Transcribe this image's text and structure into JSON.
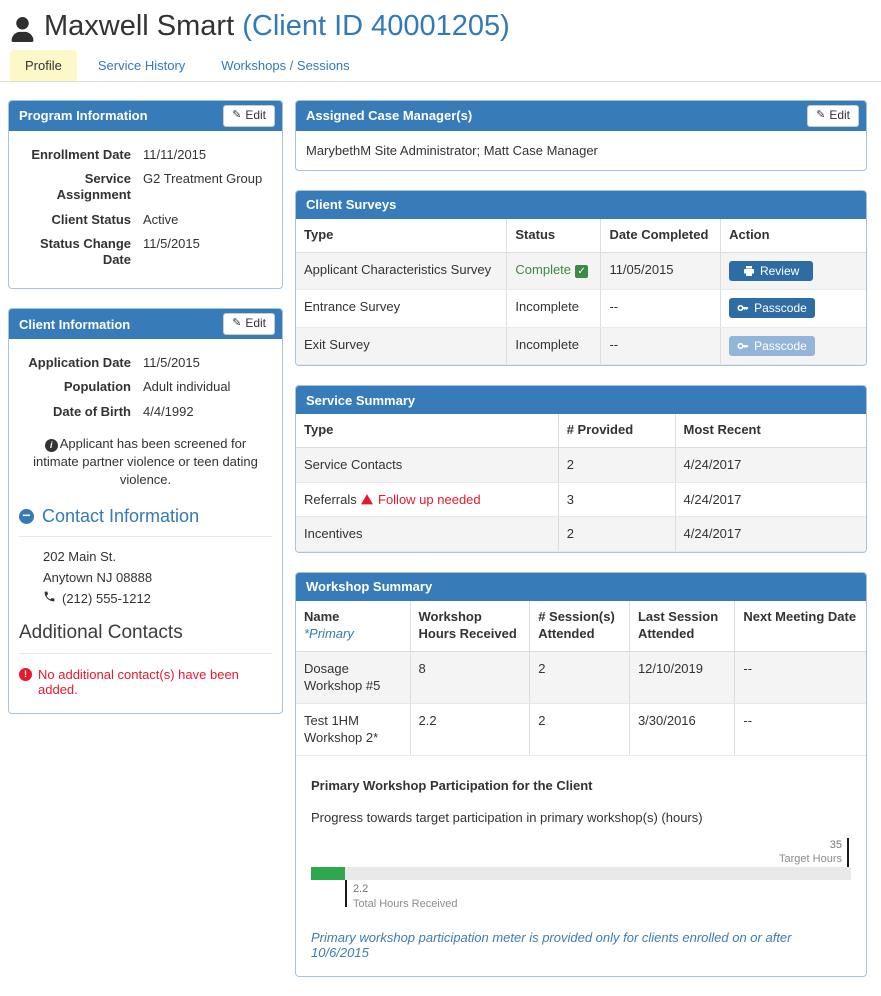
{
  "page": {
    "title": "Maxwell Smart",
    "client_id": "(Client ID 40001205)"
  },
  "tabs": {
    "profile": "Profile",
    "service_history": "Service History",
    "workshops_sessions": "Workshops / Sessions"
  },
  "icons": {
    "user": "user-silhouette",
    "edit": "pencil",
    "info": "circle-info",
    "collapse": "circle-minus",
    "phone": "phone-receiver",
    "error": "circle-exclamation",
    "complete": "check-square",
    "warning": "triangle-exclamation",
    "review": "printer",
    "passcode": "key"
  },
  "program_info": {
    "title": "Program Information",
    "edit_label": "Edit",
    "fields": [
      {
        "label": "Enrollment Date",
        "value": "11/11/2015"
      },
      {
        "label": "Service Assignment",
        "value": "G2 Treatment Group"
      },
      {
        "label": "Client Status",
        "value": "Active"
      },
      {
        "label": "Status Change Date",
        "value": "11/5/2015"
      }
    ]
  },
  "client_info": {
    "title": "Client Information",
    "edit_label": "Edit",
    "fields": [
      {
        "label": "Application Date",
        "value": "11/5/2015"
      },
      {
        "label": "Population",
        "value": "Adult individual"
      },
      {
        "label": "Date of Birth",
        "value": "4/4/1992"
      }
    ],
    "screened_note": "Applicant has been screened for intimate partner violence or teen dating violence.",
    "contact": {
      "title": "Contact Information",
      "address1": "202 Main St.",
      "address2": "Anytown NJ 08888",
      "phone": "(212) 555-1212"
    },
    "additional_contacts": {
      "title": "Additional Contacts",
      "empty_message": "No additional contact(s) have been added."
    }
  },
  "case_managers": {
    "title": "Assigned Case Manager(s)",
    "edit_label": "Edit",
    "value": "MarybethM Site Administrator; Matt Case Manager"
  },
  "client_surveys": {
    "title": "Client Surveys",
    "columns": [
      "Type",
      "Status",
      "Date Completed",
      "Action"
    ],
    "rows": [
      {
        "type": "Applicant Characteristics Survey",
        "status": "Complete",
        "date": "11/05/2015",
        "action": "Review"
      },
      {
        "type": "Entrance Survey",
        "status": "Incomplete",
        "date": "--",
        "action": "Passcode"
      },
      {
        "type": "Exit Survey",
        "status": "Incomplete",
        "date": "--",
        "action": "Passcode"
      }
    ]
  },
  "service_summary": {
    "title": "Service Summary",
    "columns": [
      "Type",
      "# Provided",
      "Most Recent"
    ],
    "rows": [
      {
        "type": "Service Contacts",
        "provided": "2",
        "recent": "4/24/2017"
      },
      {
        "type": "Referrals",
        "flag": "Follow up needed",
        "provided": "3",
        "recent": "4/24/2017"
      },
      {
        "type": "Incentives",
        "provided": "2",
        "recent": "4/24/2017"
      }
    ]
  },
  "workshop_summary": {
    "title": "Workshop Summary",
    "columns": {
      "name": "Name",
      "name_note": "*Primary",
      "hours": "Workshop Hours Received",
      "sessions": "# Session(s) Attended",
      "last": "Last Session Attended",
      "next": "Next Meeting Date"
    },
    "rows": [
      {
        "name": "Dosage Workshop #5",
        "hours": "8",
        "sessions": "2",
        "last": "12/10/2019",
        "next": "--"
      },
      {
        "name": "Test 1HM Workshop 2*",
        "hours": "2.2",
        "sessions": "2",
        "last": "3/30/2016",
        "next": "--"
      }
    ],
    "participation": {
      "heading": "Primary Workshop Participation for the Client",
      "subheading": "Progress towards target participation in primary workshop(s) (hours)",
      "footnote": "Primary workshop participation meter is provided only for clients enrolled on or after 10/6/2015"
    }
  },
  "chart_data": {
    "type": "bar",
    "title": "Progress towards target participation in primary workshop(s) (hours)",
    "series": [
      {
        "name": "Total Hours Received",
        "values": [
          2.2
        ]
      }
    ],
    "total_hours_received": 2.2,
    "target_hours": 35,
    "received_label": "Total Hours Received",
    "target_label": "Target Hours",
    "xlim": [
      0,
      35
    ],
    "bar_color": "#2ea84f",
    "track_color": "#e9e9e9"
  },
  "colors": {
    "panel_header": "#377cb8",
    "panel_border": "#a6c3dd",
    "link": "#337ab7",
    "button_primary": "#2e6da4",
    "button_disabled": "#93b5d9",
    "tab_active_bg": "#fcf8c8",
    "success_green": "#3d8b40",
    "meter_green": "#2ea84f",
    "alert_red": "#e8192c",
    "footnote_blue": "#3e7cb1"
  }
}
